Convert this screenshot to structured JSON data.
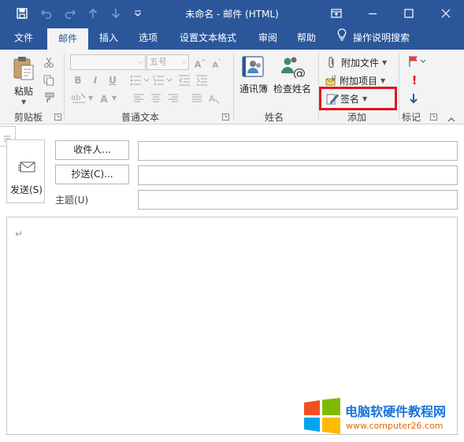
{
  "window": {
    "title": "未命名  -  邮件 (HTML)"
  },
  "tabs": [
    {
      "label": "文件"
    },
    {
      "label": "邮件"
    },
    {
      "label": "插入"
    },
    {
      "label": "选项"
    },
    {
      "label": "设置文本格式"
    },
    {
      "label": "审阅"
    },
    {
      "label": "帮助"
    }
  ],
  "tell_me": {
    "label": "操作说明搜索"
  },
  "ribbon": {
    "clipboard": {
      "paste_label": "粘贴",
      "group_label": "剪贴板"
    },
    "basic_text": {
      "font_size": "五号",
      "group_label": "普通文本",
      "bold": "B",
      "italic": "I",
      "underline": "U"
    },
    "names": {
      "address_book": "通讯簿",
      "check_names": "检查姓名",
      "group_label": "姓名"
    },
    "include": {
      "attach_file": "附加文件",
      "attach_item": "附加项目",
      "signature": "签名",
      "group_label": "添加"
    },
    "tags": {
      "group_label": "标记"
    }
  },
  "compose": {
    "send_label": "发送(S)",
    "to_label": "收件人...",
    "cc_label": "抄送(C)...",
    "subject_label": "主题(U)",
    "to_value": "",
    "cc_value": "",
    "subject_value": "",
    "body_mark": "↵"
  },
  "watermark": {
    "title": "电脑软硬件教程网",
    "url": "www.computer26.com"
  },
  "colors": {
    "accent": "#2b579a",
    "highlight": "#e0141e",
    "watermark_text": "#1a73d9"
  }
}
